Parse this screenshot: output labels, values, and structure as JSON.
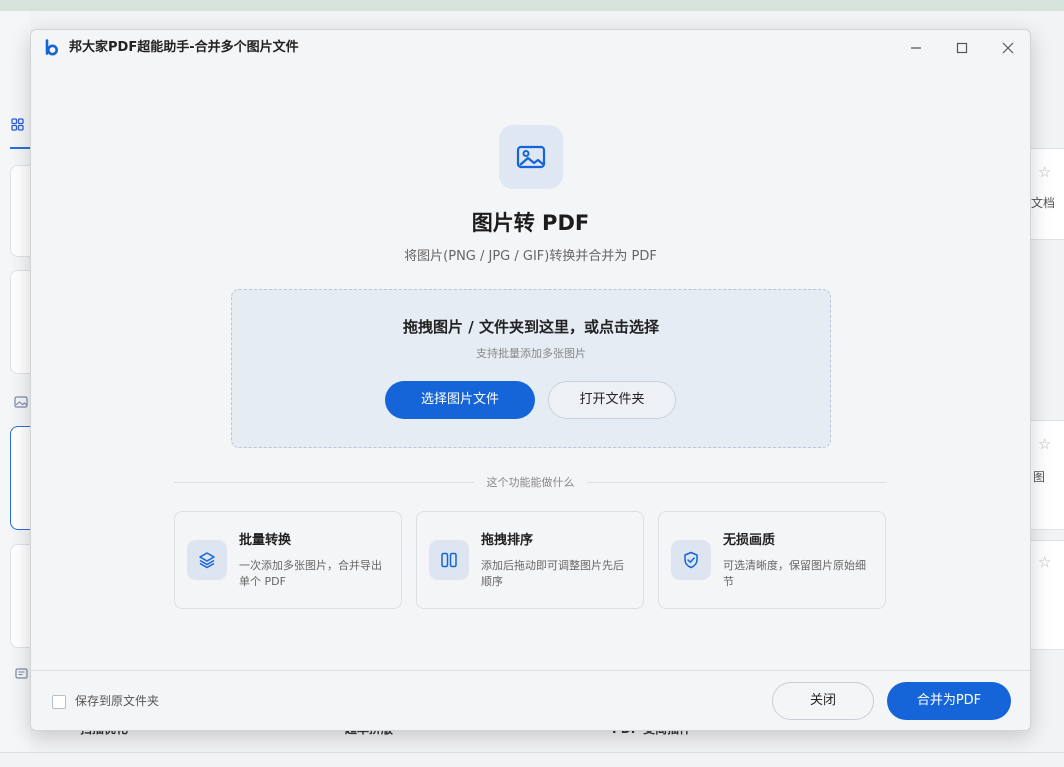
{
  "background": {
    "right_fragments": [
      "文档",
      "图"
    ],
    "bottom_fragments": [
      "扫描优化",
      "超本拼版",
      "PDF 变简插件"
    ]
  },
  "dialog": {
    "title": "邦大家PDF超能助手-合并多个图片文件",
    "hero": {
      "icon": "image-icon",
      "title": "图片转 PDF",
      "subtitle": "将图片(PNG / JPG / GIF)转换并合并为 PDF"
    },
    "dropzone": {
      "main_text": "拖拽图片 / 文件夹到这里，或点击选择",
      "hint": "支持批量添加多张图片",
      "select_button": "选择图片文件",
      "open_folder_button": "打开文件夹"
    },
    "divider_label": "这个功能能做什么",
    "features": [
      {
        "icon": "layers-icon",
        "title": "批量转换",
        "desc": "一次添加多张图片，合并导出单个 PDF"
      },
      {
        "icon": "columns-icon",
        "title": "拖拽排序",
        "desc": "添加后拖动即可调整图片先后顺序"
      },
      {
        "icon": "shield-check-icon",
        "title": "无损画质",
        "desc": "可选清晰度，保留图片原始细节"
      }
    ],
    "footer": {
      "checkbox_label": "保存到原文件夹",
      "checkbox_checked": false,
      "close_button": "关闭",
      "merge_button": "合并为PDF"
    }
  },
  "colors": {
    "primary": "#1565d8",
    "icon_tile": "#dfe7f3"
  }
}
